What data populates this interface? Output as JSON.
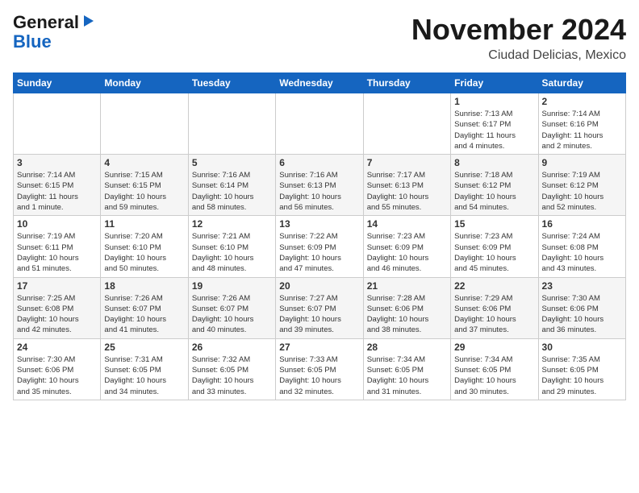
{
  "header": {
    "logo_line1": "General",
    "logo_line2": "Blue",
    "month_title": "November 2024",
    "location": "Ciudad Delicias, Mexico"
  },
  "weekdays": [
    "Sunday",
    "Monday",
    "Tuesday",
    "Wednesday",
    "Thursday",
    "Friday",
    "Saturday"
  ],
  "weeks": [
    [
      {
        "day": "",
        "info": ""
      },
      {
        "day": "",
        "info": ""
      },
      {
        "day": "",
        "info": ""
      },
      {
        "day": "",
        "info": ""
      },
      {
        "day": "",
        "info": ""
      },
      {
        "day": "1",
        "info": "Sunrise: 7:13 AM\nSunset: 6:17 PM\nDaylight: 11 hours\nand 4 minutes."
      },
      {
        "day": "2",
        "info": "Sunrise: 7:14 AM\nSunset: 6:16 PM\nDaylight: 11 hours\nand 2 minutes."
      }
    ],
    [
      {
        "day": "3",
        "info": "Sunrise: 7:14 AM\nSunset: 6:15 PM\nDaylight: 11 hours\nand 1 minute."
      },
      {
        "day": "4",
        "info": "Sunrise: 7:15 AM\nSunset: 6:15 PM\nDaylight: 10 hours\nand 59 minutes."
      },
      {
        "day": "5",
        "info": "Sunrise: 7:16 AM\nSunset: 6:14 PM\nDaylight: 10 hours\nand 58 minutes."
      },
      {
        "day": "6",
        "info": "Sunrise: 7:16 AM\nSunset: 6:13 PM\nDaylight: 10 hours\nand 56 minutes."
      },
      {
        "day": "7",
        "info": "Sunrise: 7:17 AM\nSunset: 6:13 PM\nDaylight: 10 hours\nand 55 minutes."
      },
      {
        "day": "8",
        "info": "Sunrise: 7:18 AM\nSunset: 6:12 PM\nDaylight: 10 hours\nand 54 minutes."
      },
      {
        "day": "9",
        "info": "Sunrise: 7:19 AM\nSunset: 6:12 PM\nDaylight: 10 hours\nand 52 minutes."
      }
    ],
    [
      {
        "day": "10",
        "info": "Sunrise: 7:19 AM\nSunset: 6:11 PM\nDaylight: 10 hours\nand 51 minutes."
      },
      {
        "day": "11",
        "info": "Sunrise: 7:20 AM\nSunset: 6:10 PM\nDaylight: 10 hours\nand 50 minutes."
      },
      {
        "day": "12",
        "info": "Sunrise: 7:21 AM\nSunset: 6:10 PM\nDaylight: 10 hours\nand 48 minutes."
      },
      {
        "day": "13",
        "info": "Sunrise: 7:22 AM\nSunset: 6:09 PM\nDaylight: 10 hours\nand 47 minutes."
      },
      {
        "day": "14",
        "info": "Sunrise: 7:23 AM\nSunset: 6:09 PM\nDaylight: 10 hours\nand 46 minutes."
      },
      {
        "day": "15",
        "info": "Sunrise: 7:23 AM\nSunset: 6:09 PM\nDaylight: 10 hours\nand 45 minutes."
      },
      {
        "day": "16",
        "info": "Sunrise: 7:24 AM\nSunset: 6:08 PM\nDaylight: 10 hours\nand 43 minutes."
      }
    ],
    [
      {
        "day": "17",
        "info": "Sunrise: 7:25 AM\nSunset: 6:08 PM\nDaylight: 10 hours\nand 42 minutes."
      },
      {
        "day": "18",
        "info": "Sunrise: 7:26 AM\nSunset: 6:07 PM\nDaylight: 10 hours\nand 41 minutes."
      },
      {
        "day": "19",
        "info": "Sunrise: 7:26 AM\nSunset: 6:07 PM\nDaylight: 10 hours\nand 40 minutes."
      },
      {
        "day": "20",
        "info": "Sunrise: 7:27 AM\nSunset: 6:07 PM\nDaylight: 10 hours\nand 39 minutes."
      },
      {
        "day": "21",
        "info": "Sunrise: 7:28 AM\nSunset: 6:06 PM\nDaylight: 10 hours\nand 38 minutes."
      },
      {
        "day": "22",
        "info": "Sunrise: 7:29 AM\nSunset: 6:06 PM\nDaylight: 10 hours\nand 37 minutes."
      },
      {
        "day": "23",
        "info": "Sunrise: 7:30 AM\nSunset: 6:06 PM\nDaylight: 10 hours\nand 36 minutes."
      }
    ],
    [
      {
        "day": "24",
        "info": "Sunrise: 7:30 AM\nSunset: 6:06 PM\nDaylight: 10 hours\nand 35 minutes."
      },
      {
        "day": "25",
        "info": "Sunrise: 7:31 AM\nSunset: 6:05 PM\nDaylight: 10 hours\nand 34 minutes."
      },
      {
        "day": "26",
        "info": "Sunrise: 7:32 AM\nSunset: 6:05 PM\nDaylight: 10 hours\nand 33 minutes."
      },
      {
        "day": "27",
        "info": "Sunrise: 7:33 AM\nSunset: 6:05 PM\nDaylight: 10 hours\nand 32 minutes."
      },
      {
        "day": "28",
        "info": "Sunrise: 7:34 AM\nSunset: 6:05 PM\nDaylight: 10 hours\nand 31 minutes."
      },
      {
        "day": "29",
        "info": "Sunrise: 7:34 AM\nSunset: 6:05 PM\nDaylight: 10 hours\nand 30 minutes."
      },
      {
        "day": "30",
        "info": "Sunrise: 7:35 AM\nSunset: 6:05 PM\nDaylight: 10 hours\nand 29 minutes."
      }
    ]
  ]
}
